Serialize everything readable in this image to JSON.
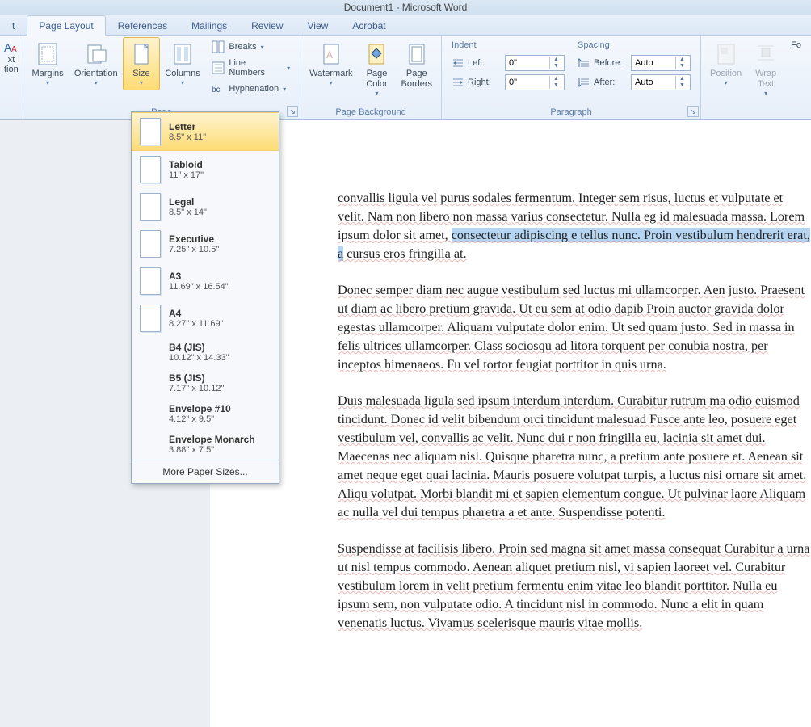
{
  "window": {
    "title": "Document1 - Microsoft Word"
  },
  "tabs": {
    "t_cut": "t",
    "page_layout": "Page Layout",
    "references": "References",
    "mailings": "Mailings",
    "review": "Review",
    "view": "View",
    "acrobat": "Acrobat"
  },
  "ribbon": {
    "themes": {
      "xt": "xt",
      "tion": "tion",
      "group_label_cut": "Page"
    },
    "page_setup": {
      "margins": "Margins",
      "orientation": "Orientation",
      "size": "Size",
      "columns": "Columns",
      "breaks": "Breaks",
      "line_numbers": "Line Numbers",
      "hyphenation": "Hyphenation"
    },
    "page_background": {
      "watermark": "Watermark",
      "page_color": "Page\nColor",
      "page_borders": "Page\nBorders",
      "group_label": "Page Background"
    },
    "paragraph": {
      "indent_title": "Indent",
      "spacing_title": "Spacing",
      "left_label": "Left:",
      "right_label": "Right:",
      "before_label": "Before:",
      "after_label": "After:",
      "left_val": "0\"",
      "right_val": "0\"",
      "before_val": "Auto",
      "after_val": "Auto",
      "group_label": "Paragraph"
    },
    "arrange": {
      "position": "Position",
      "wrap_text": "Wrap\nText",
      "fo": "Fo"
    }
  },
  "size_menu": {
    "items": [
      {
        "name": "Letter",
        "dim": "8.5\" x 11\"",
        "icon": true,
        "hl": true
      },
      {
        "name": "Tabloid",
        "dim": "11\" x 17\"",
        "icon": true,
        "hl": false
      },
      {
        "name": "Legal",
        "dim": "8.5\" x 14\"",
        "icon": true,
        "hl": false
      },
      {
        "name": "Executive",
        "dim": "7.25\" x 10.5\"",
        "icon": true,
        "hl": false
      },
      {
        "name": "A3",
        "dim": "11.69\" x 16.54\"",
        "icon": true,
        "hl": false
      },
      {
        "name": "A4",
        "dim": "8.27\" x 11.69\"",
        "icon": true,
        "hl": false
      },
      {
        "name": "B4 (JIS)",
        "dim": "10.12\" x 14.33\"",
        "icon": false,
        "hl": false
      },
      {
        "name": "B5 (JIS)",
        "dim": "7.17\" x 10.12\"",
        "icon": false,
        "hl": false
      },
      {
        "name": "Envelope #10",
        "dim": "4.12\" x 9.5\"",
        "icon": false,
        "hl": false
      },
      {
        "name": "Envelope Monarch",
        "dim": "3.88\" x 7.5\"",
        "icon": false,
        "hl": false
      }
    ],
    "more": "More Paper Sizes..."
  },
  "document": {
    "p1": "convallis ligula vel purus sodales fermentum. Integer sem risus, luctus et vulputate et velit. Nam non libero non massa varius consectetur. Nulla eg id malesuada massa. Lorem ipsum dolor sit amet, ",
    "p1_sel": "consectetur adipiscing e tellus nunc. Proin vestibulum hendrerit erat, a",
    "p1_end": " cursus eros fringilla at.",
    "p2": "Donec semper diam nec augue vestibulum sed luctus mi ullamcorper. Aen justo. Praesent ut diam ac libero pretium gravida. Ut eu sem at odio dapib Proin auctor gravida dolor egestas ullamcorper. Aliquam vulputate dolor enim. Ut sed quam justo. Sed in massa in felis ultrices ullamcorper. Class sociosqu ad litora torquent per conubia nostra, per inceptos himenaeos. Fu vel tortor feugiat porttitor in quis urna.",
    "p3": "Duis malesuada ligula sed ipsum interdum interdum. Curabitur rutrum ma odio euismod tincidunt. Donec id velit bibendum orci tincidunt malesuad Fusce ante leo, posuere eget vestibulum vel, convallis ac velit. Nunc dui r non fringilla eu, lacinia sit amet dui. Maecenas nec aliquam nisl. Quisque pharetra nunc, a pretium ante posuere et. Aenean sit amet neque eget quai lacinia. Mauris posuere volutpat turpis, a luctus nisi ornare sit amet. Aliqu volutpat. Morbi blandit mi et sapien elementum congue. Ut pulvinar laore Aliquam ac nulla vel dui tempus pharetra a et ante. Suspendisse potenti.",
    "p4": "Suspendisse at facilisis libero. Proin sed magna sit amet massa consequat Curabitur a urna ut nisl tempus commodo. Aenean aliquet pretium nisl, vi sapien laoreet vel. Curabitur vestibulum lorem in velit pretium fermentu enim vitae leo blandit porttitor. Nulla eu ipsum sem, non vulputate odio. A tincidunt nisl in commodo. Nunc a elit in quam venenatis luctus. Vivamus scelerisque mauris vitae mollis."
  }
}
